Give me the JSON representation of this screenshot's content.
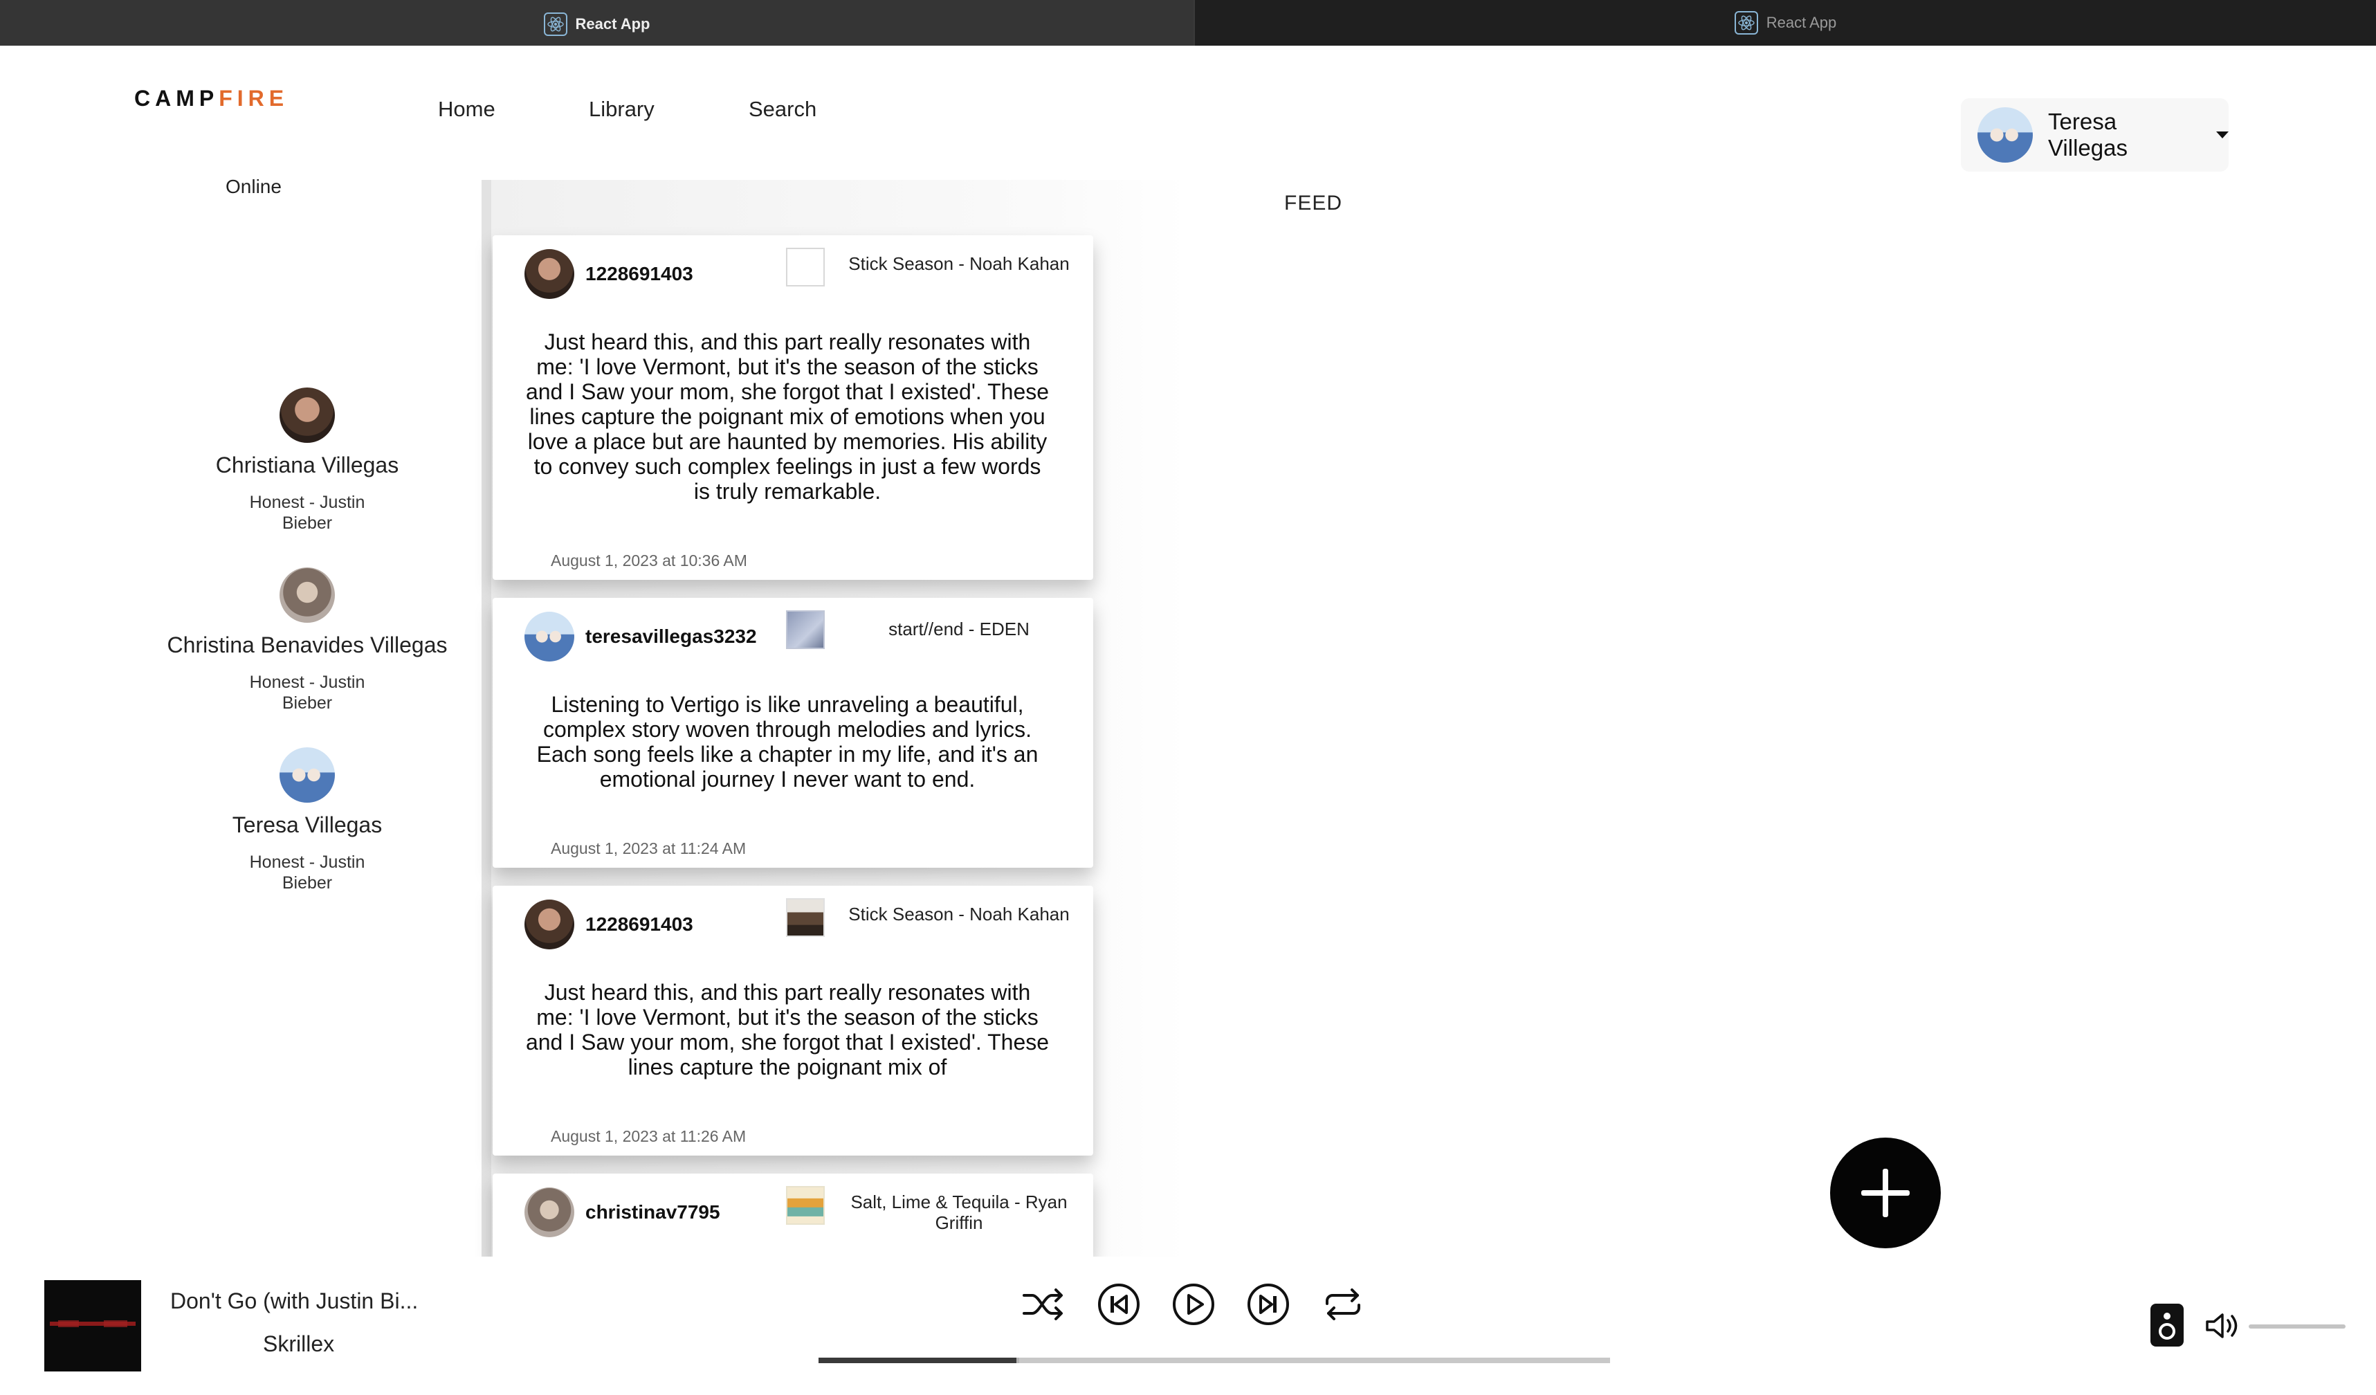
{
  "browser": {
    "tabs": [
      {
        "label": "React App",
        "active": true
      },
      {
        "label": "React App",
        "active": false
      }
    ]
  },
  "header": {
    "logo_part1": "CAMP",
    "logo_part2": "FIRE",
    "nav": [
      {
        "label": "Home"
      },
      {
        "label": "Library"
      },
      {
        "label": "Search"
      }
    ],
    "user": {
      "name": "Teresa Villegas"
    }
  },
  "sidebar": {
    "title": "Online",
    "friends": [
      {
        "name": "Christiana Villegas",
        "song": "Honest - Justin Bieber"
      },
      {
        "name": "Christina Benavides Villegas",
        "song": "Honest - Justin Bieber"
      },
      {
        "name": "Teresa Villegas",
        "song": "Honest - Justin Bieber"
      }
    ]
  },
  "feed": {
    "title": "FEED",
    "posts": [
      {
        "username": "1228691403",
        "song": "Stick Season - Noah Kahan",
        "text": "Just heard this, and this part really resonates with me: 'I love Vermont, but it's the season of the sticks and I Saw your mom, she forgot that I existed'. These lines capture the poignant mix of emotions when you love a place but are haunted by memories. His ability to convey such complex feelings in just a few words is truly remarkable.",
        "date": "August 1, 2023 at 10:36 AM"
      },
      {
        "username": "teresavillegas3232",
        "song": "start//end - EDEN",
        "text": "Listening to Vertigo is like unraveling a beautiful, complex story woven through melodies and lyrics. Each song feels like a chapter in my life, and it's an emotional journey I never want to end.",
        "date": "August 1, 2023 at 11:24 AM"
      },
      {
        "username": "1228691403",
        "song": "Stick Season - Noah Kahan",
        "text": "Just heard this, and this part really resonates with me: 'I love Vermont, but it's the season of the sticks and I Saw your mom, she forgot that I existed'. These lines capture the poignant mix of",
        "date": "August 1, 2023 at 11:26 AM"
      },
      {
        "username": "christinav7795",
        "song": "Salt, Lime & Tequila - Ryan Griffin",
        "text": "",
        "date": ""
      }
    ]
  },
  "player": {
    "title": "Don't Go (with Justin Bi...",
    "artist": "Skrillex",
    "progress": 0.25,
    "controls": [
      "shuffle-icon",
      "previous-icon",
      "play-icon",
      "next-icon",
      "repeat-icon"
    ]
  },
  "colors": {
    "accent": "#e26a2c",
    "fab": "#050505",
    "tab_active": "#353535"
  }
}
